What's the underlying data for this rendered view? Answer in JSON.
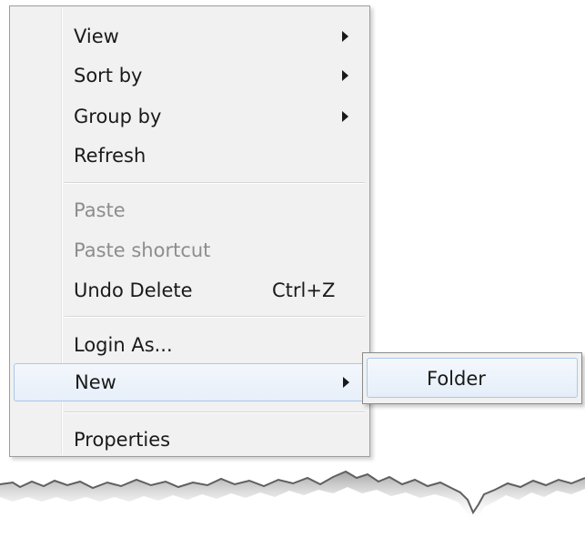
{
  "context_menu": {
    "items": [
      {
        "label": "View",
        "has_submenu": true
      },
      {
        "label": "Sort by",
        "has_submenu": true
      },
      {
        "label": "Group by",
        "has_submenu": true
      },
      {
        "label": "Refresh"
      },
      {
        "label": "Paste",
        "disabled": true
      },
      {
        "label": "Paste shortcut",
        "disabled": true
      },
      {
        "label": "Undo Delete",
        "shortcut": "Ctrl+Z"
      },
      {
        "label": "Login As..."
      },
      {
        "label": "New",
        "has_submenu": true,
        "highlighted": true
      },
      {
        "label": "Properties"
      }
    ]
  },
  "submenu": {
    "items": [
      {
        "label": "Folder",
        "highlighted": true
      }
    ]
  },
  "colors": {
    "menu_background": "#f1f1f1",
    "highlight_border": "#a9c8ea",
    "disabled_text": "#8d8d8d"
  }
}
